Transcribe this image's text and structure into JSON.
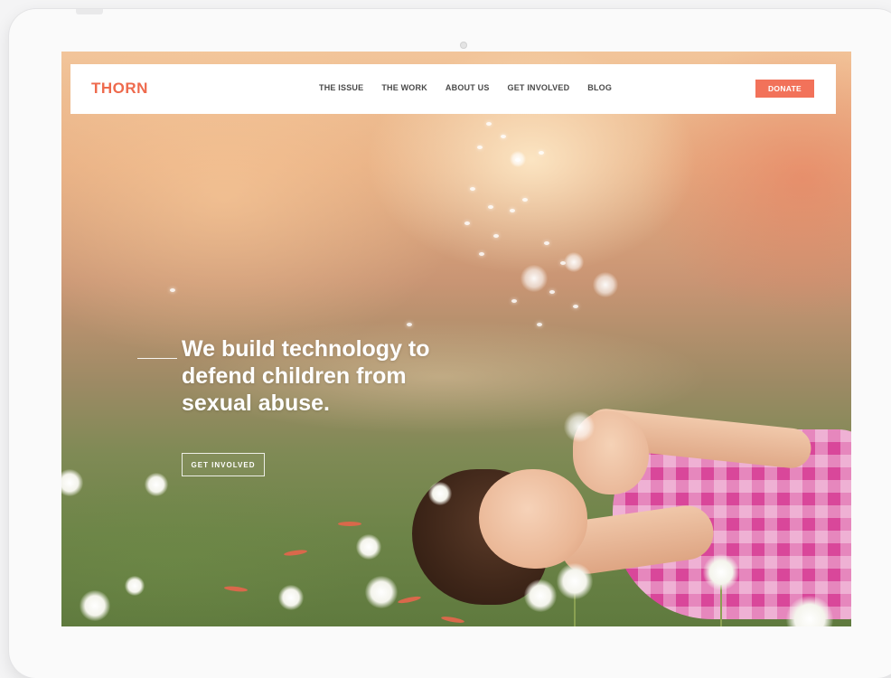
{
  "header": {
    "logo": "THORN",
    "nav": [
      {
        "label": "THE ISSUE"
      },
      {
        "label": "THE WORK"
      },
      {
        "label": "ABOUT US"
      },
      {
        "label": "GET INVOLVED"
      },
      {
        "label": "BLOG"
      }
    ],
    "donate_label": "DONATE"
  },
  "hero": {
    "headline": "We build technology to defend children from sexual abuse.",
    "cta_label": "GET INVOLVED"
  },
  "colors": {
    "brand": "#ee6a4d",
    "donate": "#f2725a"
  }
}
